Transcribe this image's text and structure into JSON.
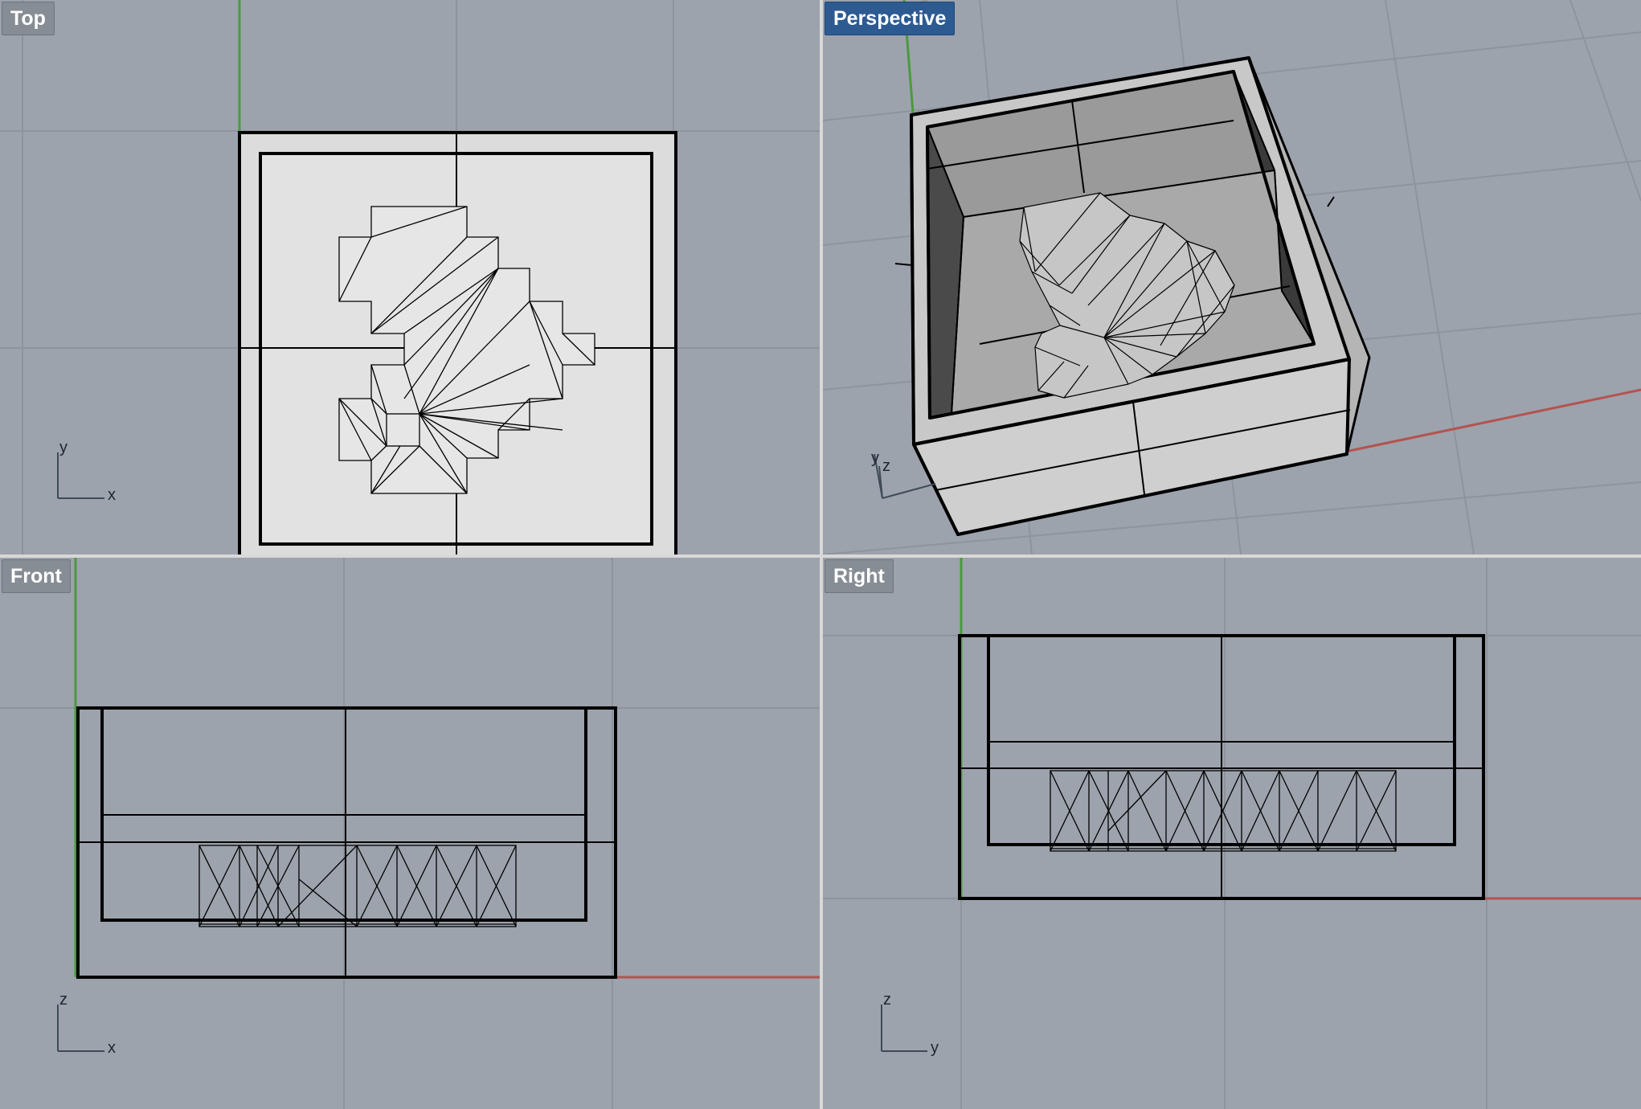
{
  "viewports": {
    "top": {
      "title": "Top",
      "axes": {
        "vertical": "y",
        "horizontal": "x"
      }
    },
    "perspective": {
      "title": "Perspective",
      "axes": {
        "vertical": "y",
        "horizontal": "z"
      }
    },
    "front": {
      "title": "Front",
      "axes": {
        "vertical": "z",
        "horizontal": "x"
      }
    },
    "right": {
      "title": "Right",
      "axes": {
        "vertical": "z",
        "horizontal": "y"
      }
    }
  },
  "active_viewport": "Perspective",
  "colors": {
    "viewport_background": "#9ca3ac",
    "grid_line": "#8d949c",
    "x_axis": "#b5524f",
    "y_axis": "#4a9a3e",
    "title_tab": "#878d94",
    "active_title_tab": "#2d5a91",
    "object_fill": "#dcdcdc",
    "wire": "#000000"
  }
}
